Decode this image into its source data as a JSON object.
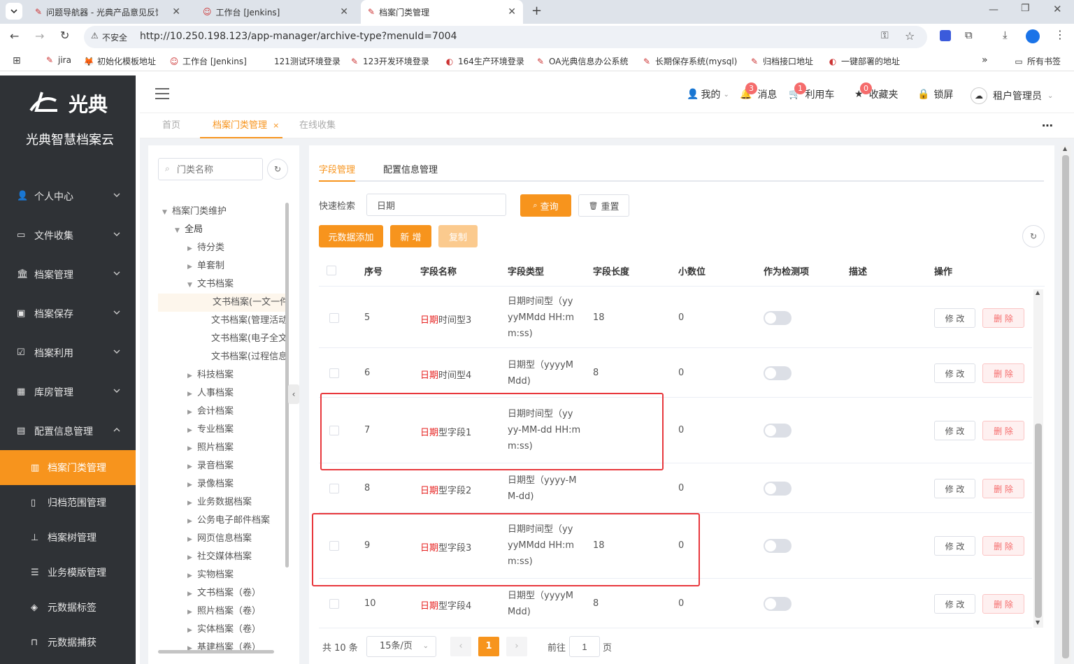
{
  "browser": {
    "tabs": [
      {
        "title": "问题导航器 - 光典产品意见反馈",
        "icon": "bug-icon"
      },
      {
        "title": "工作台 [Jenkins]",
        "icon": "jenkins-icon"
      },
      {
        "title": "档案门类管理",
        "icon": "bug-icon",
        "active": true
      }
    ],
    "security_label": "不安全",
    "url": "http://10.250.198.123/app-manager/archive-type?menuId=7004",
    "bookmarks": [
      "jira",
      "初始化模板地址",
      "工作台 [Jenkins]",
      "121测试环境登录",
      "123开发环境登录",
      "164生产环境登录",
      "OA光典信息办公系统",
      "长期保存系统(mysql)",
      "归档接口地址",
      "一键部署的地址"
    ],
    "all_bookmarks": "所有书签",
    "more": "»"
  },
  "brand": {
    "logo_text": "光典",
    "name": "光典智慧档案云"
  },
  "sidebar": {
    "menus": [
      {
        "label": "个人中心",
        "icon": "user-icon"
      },
      {
        "label": "文件收集",
        "icon": "inbox-icon"
      },
      {
        "label": "档案管理",
        "icon": "bank-icon"
      },
      {
        "label": "档案保存",
        "icon": "save-icon"
      },
      {
        "label": "档案利用",
        "icon": "clipboard-check-icon"
      },
      {
        "label": "库房管理",
        "icon": "building-icon"
      },
      {
        "label": "配置信息管理",
        "icon": "config-icon"
      }
    ],
    "submenus": [
      {
        "label": "档案门类管理",
        "icon": "category-icon",
        "active": true
      },
      {
        "label": "归档范围管理",
        "icon": "document-icon"
      },
      {
        "label": "档案树管理",
        "icon": "tree-icon"
      },
      {
        "label": "业务模版管理",
        "icon": "template-icon"
      },
      {
        "label": "元数据标签",
        "icon": "tag-icon"
      },
      {
        "label": "元数据捕获",
        "icon": "capture-icon"
      }
    ]
  },
  "topbar": {
    "mine": "我的",
    "messages": "消息",
    "messages_count": "3",
    "cart": "利用车",
    "cart_count": "1",
    "favorites": "收藏夹",
    "favorites_count": "0",
    "lock": "锁屏",
    "user": "租户管理员"
  },
  "page_tabs": [
    {
      "label": "首页"
    },
    {
      "label": "档案门类管理",
      "active": true
    },
    {
      "label": "在线收集"
    }
  ],
  "tree": {
    "search_placeholder": "门类名称",
    "nodes": [
      {
        "label": "档案门类维护",
        "level": 0,
        "caret": "down"
      },
      {
        "label": "全局",
        "level": 1,
        "caret": "down"
      },
      {
        "label": "待分类",
        "level": 2,
        "caret": "right"
      },
      {
        "label": "单套制",
        "level": 2,
        "caret": "right"
      },
      {
        "label": "文书档案",
        "level": 2,
        "caret": "down"
      },
      {
        "label": "文书档案(一文一件)",
        "level": 3,
        "caret": "",
        "selected": true
      },
      {
        "label": "文书档案(管理活动)",
        "level": 3,
        "caret": ""
      },
      {
        "label": "文书档案(电子全文)",
        "level": 3,
        "caret": ""
      },
      {
        "label": "文书档案(过程信息)",
        "level": 3,
        "caret": ""
      },
      {
        "label": "科技档案",
        "level": 2,
        "caret": "right"
      },
      {
        "label": "人事档案",
        "level": 2,
        "caret": "right"
      },
      {
        "label": "会计档案",
        "level": 2,
        "caret": "right"
      },
      {
        "label": "专业档案",
        "level": 2,
        "caret": "right"
      },
      {
        "label": "照片档案",
        "level": 2,
        "caret": "right"
      },
      {
        "label": "录音档案",
        "level": 2,
        "caret": "right"
      },
      {
        "label": "录像档案",
        "level": 2,
        "caret": "right"
      },
      {
        "label": "业务数据档案",
        "level": 2,
        "caret": "right"
      },
      {
        "label": "公务电子邮件档案",
        "level": 2,
        "caret": "right"
      },
      {
        "label": "网页信息档案",
        "level": 2,
        "caret": "right"
      },
      {
        "label": "社交媒体档案",
        "level": 2,
        "caret": "right"
      },
      {
        "label": "实物档案",
        "level": 2,
        "caret": "right"
      },
      {
        "label": "文书档案（卷）",
        "level": 2,
        "caret": "right"
      },
      {
        "label": "照片档案（卷）",
        "level": 2,
        "caret": "right"
      },
      {
        "label": "实体档案（卷）",
        "level": 2,
        "caret": "right"
      },
      {
        "label": "基建档案（卷）",
        "level": 2,
        "caret": "right"
      }
    ]
  },
  "main": {
    "tabs": [
      {
        "label": "字段管理",
        "active": true
      },
      {
        "label": "配置信息管理"
      }
    ],
    "search_label": "快速检索",
    "search_value": "日期",
    "query_button": "查询",
    "reset_button": "重置",
    "metadata_add_button": "元数据添加",
    "new_button": "新 增",
    "copy_button": "复制",
    "columns": [
      "序号",
      "字段名称",
      "字段类型",
      "字段长度",
      "小数位",
      "作为检测项",
      "描述",
      "操作"
    ],
    "rows": [
      {
        "no": "5",
        "name_hl": "日期",
        "name_rest": "时间型3",
        "type": [
          "日期时间型（yy",
          "yyMMdd HH:m",
          "m:ss)"
        ],
        "length": "18",
        "decimal": "0",
        "check": false,
        "desc": ""
      },
      {
        "no": "6",
        "name_hl": "日期",
        "name_rest": "时间型4",
        "type": [
          "日期型（yyyyM",
          "Mdd)"
        ],
        "length": "8",
        "decimal": "0",
        "check": false,
        "desc": ""
      },
      {
        "no": "7",
        "name_hl": "日期",
        "name_rest": "型字段1",
        "type": [
          "日期时间型（yy",
          "yy-MM-dd HH:m",
          "m:ss)"
        ],
        "length": "",
        "decimal": "0",
        "check": false,
        "desc": ""
      },
      {
        "no": "8",
        "name_hl": "日期",
        "name_rest": "型字段2",
        "type": [
          "日期型（yyyy-M",
          "M-dd)"
        ],
        "length": "",
        "decimal": "0",
        "check": false,
        "desc": ""
      },
      {
        "no": "9",
        "name_hl": "日期",
        "name_rest": "型字段3",
        "type": [
          "日期时间型（yy",
          "yyMMdd HH:m",
          "m:ss)"
        ],
        "length": "18",
        "decimal": "0",
        "check": false,
        "desc": ""
      },
      {
        "no": "10",
        "name_hl": "日期",
        "name_rest": "型字段4",
        "type": [
          "日期型（yyyyM",
          "Mdd)"
        ],
        "length": "8",
        "decimal": "0",
        "check": false,
        "desc": ""
      }
    ],
    "edit_label": "修 改",
    "delete_label": "删 除",
    "pagination": {
      "total": "共 10 条",
      "page_size": "15条/页",
      "current": "1",
      "goto_prefix": "前往",
      "goto_value": "1",
      "goto_suffix": "页"
    }
  },
  "colors": {
    "accent": "#f7941d",
    "sidebar": "#2f3236",
    "danger": "#e6201f",
    "highlight_box": "#e8383d"
  }
}
